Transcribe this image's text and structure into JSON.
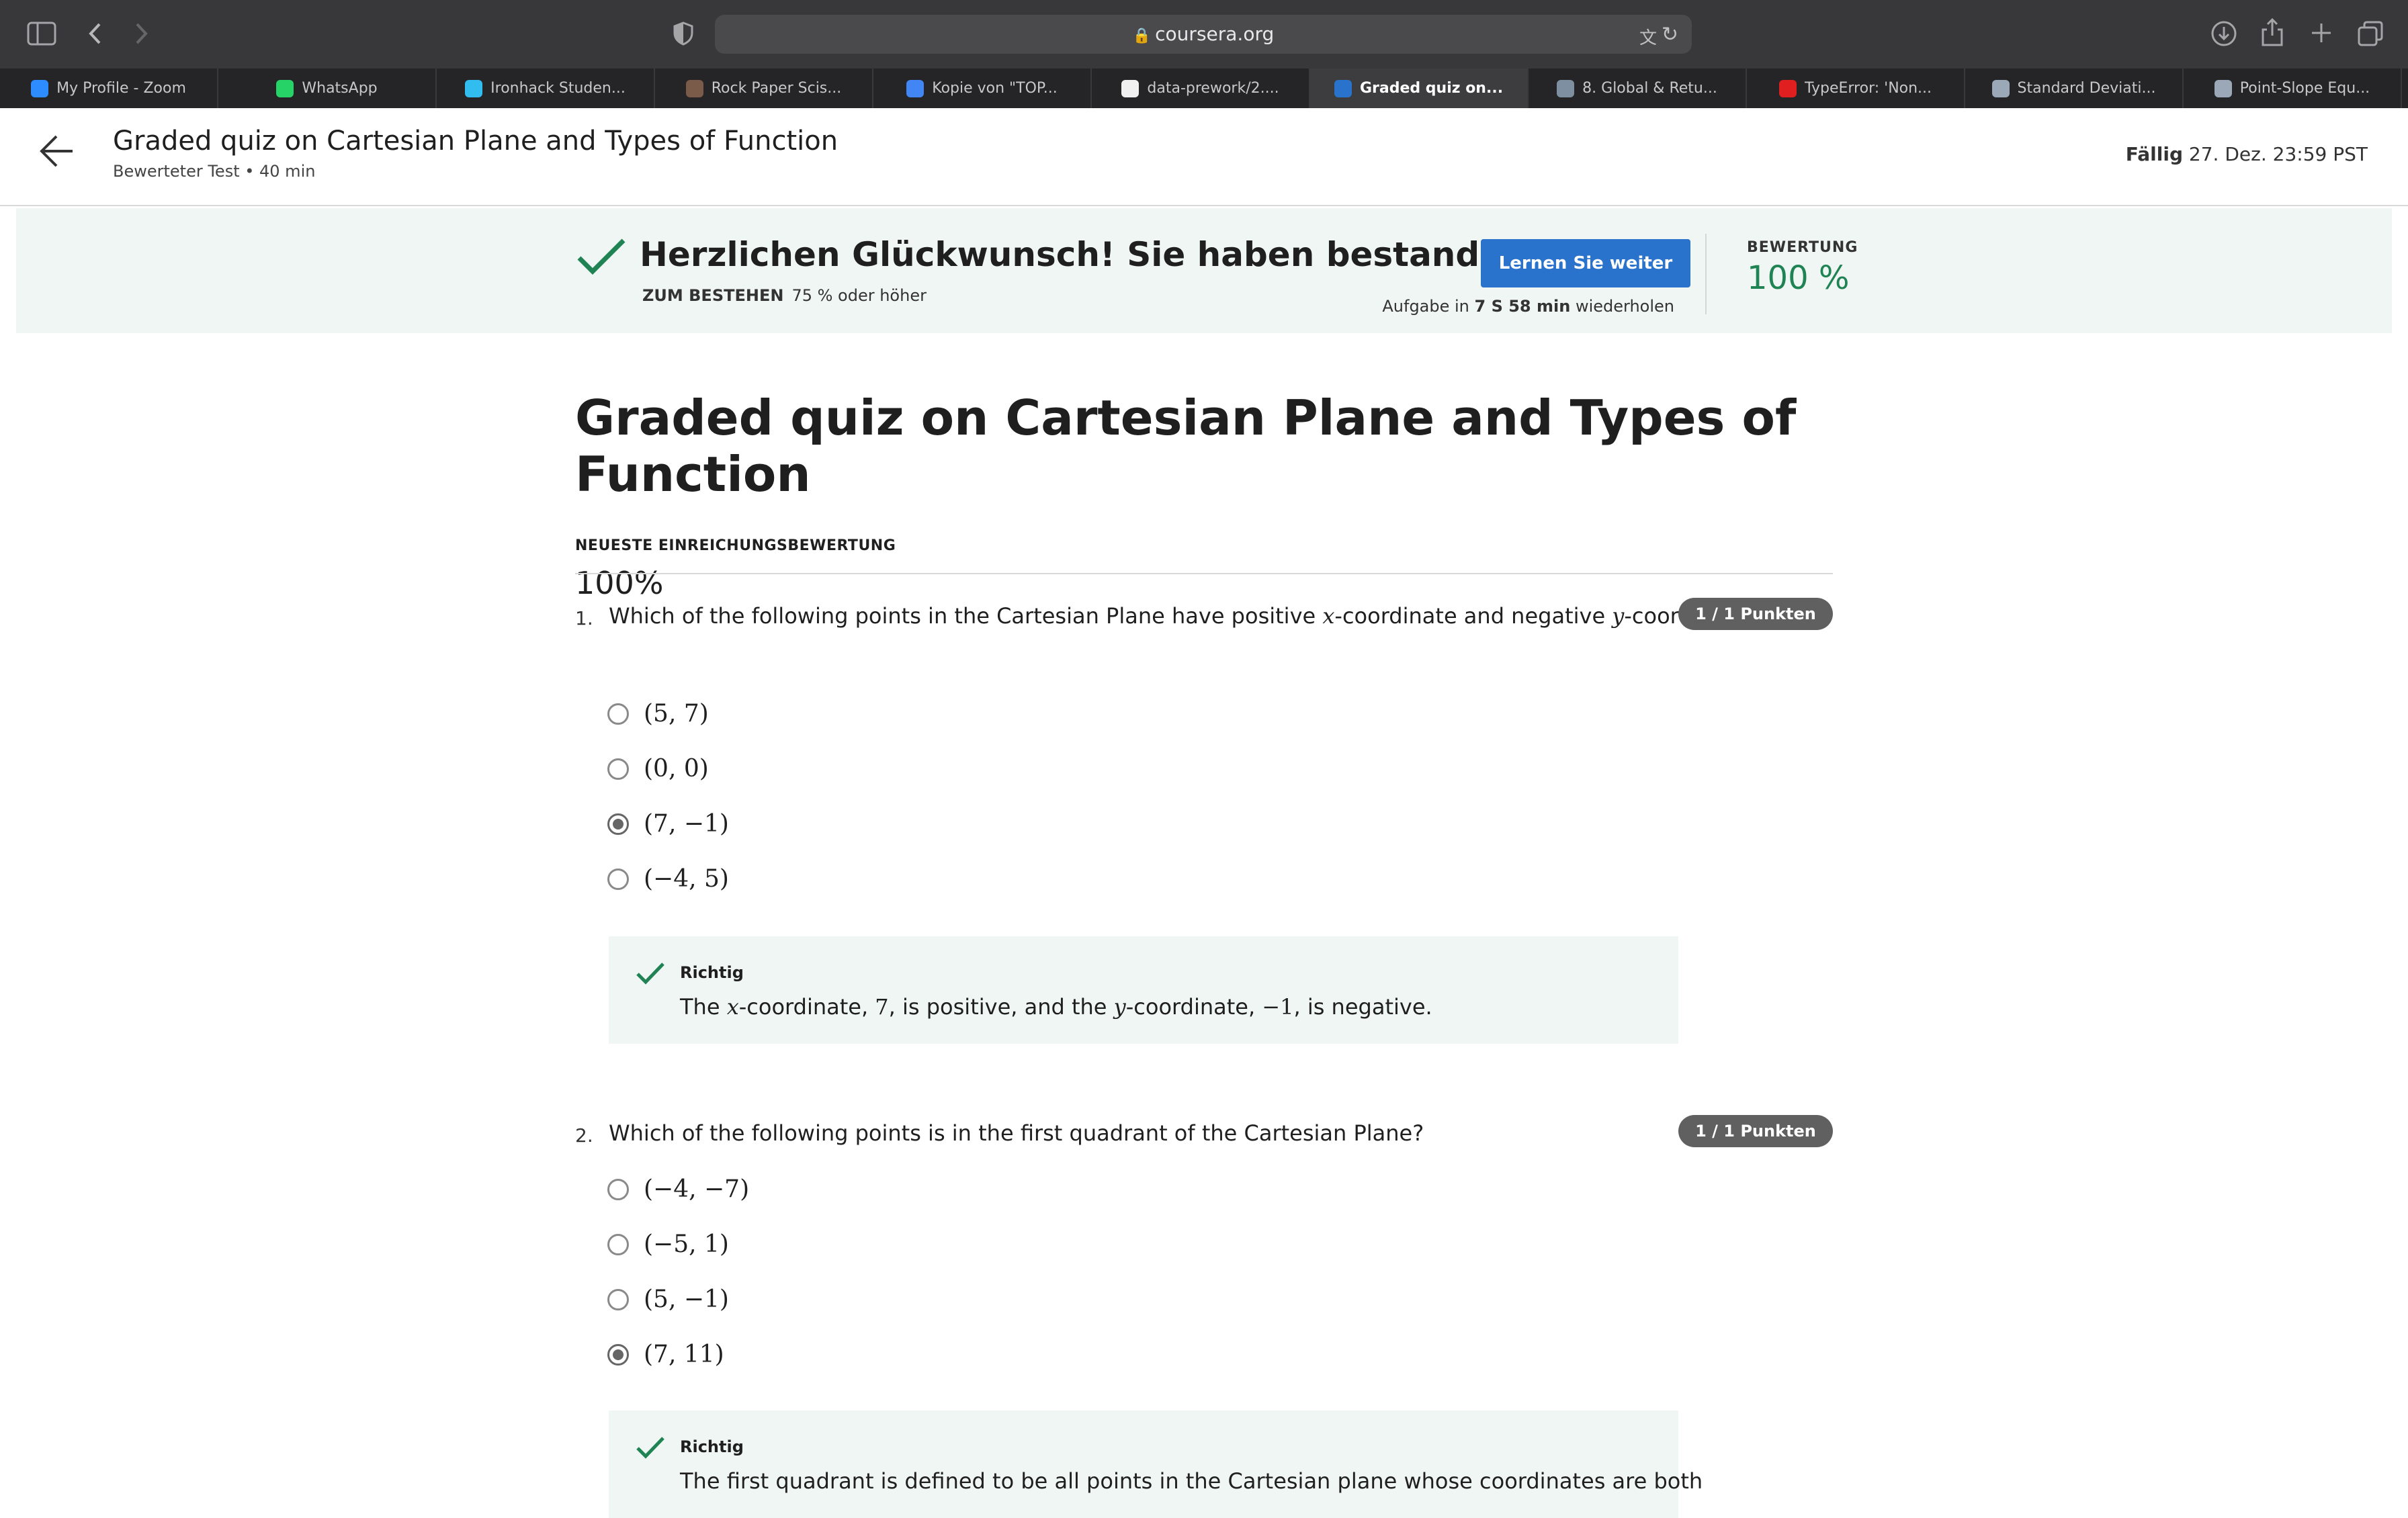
{
  "browser": {
    "url": "coursera.org",
    "tabs": [
      {
        "label": "My Profile - Zoom",
        "color": "#2d8cff"
      },
      {
        "label": "WhatsApp",
        "color": "#25d366"
      },
      {
        "label": "Ironhack Studen...",
        "color": "#32bdf0"
      },
      {
        "label": "Rock Paper Scis...",
        "color": "#7a5a48"
      },
      {
        "label": "Kopie von \"TOP...",
        "color": "#4285f4"
      },
      {
        "label": "data-prework/2....",
        "color": "#f0f0f0"
      },
      {
        "label": "Graded quiz on...",
        "color": "#2a73cc",
        "active": true
      },
      {
        "label": "8. Global & Retu...",
        "color": "#7d8fa0"
      },
      {
        "label": "TypeError: 'Non...",
        "color": "#e02020"
      },
      {
        "label": "Standard Deviati...",
        "color": "#9aa8b8"
      },
      {
        "label": "Point-Slope Equ...",
        "color": "#9aa8b8"
      }
    ]
  },
  "header": {
    "title": "Graded quiz on Cartesian Plane and Types of Function",
    "subtitle": "Bewerteter Test • 40 min",
    "due_label": "Fällig",
    "due_value": "27. Dez. 23:59 PST"
  },
  "banner": {
    "title": "Herzlichen Glückwunsch! Sie haben bestanden!",
    "pass_label": "ZUM BESTEHEN",
    "pass_value": "75 % oder höher",
    "continue_button": "Lernen Sie weiter",
    "retry_prefix": "Aufgabe in",
    "retry_time": "7 S 58 min",
    "retry_suffix": "wiederholen",
    "grade_label": "BEWERTUNG",
    "grade_value": "100 %"
  },
  "main": {
    "title": "Graded quiz on Cartesian Plane and Types of Function",
    "latest_label": "NEUESTE EINREICHUNGSBEWERTUNG",
    "latest_value": "100%"
  },
  "questions": [
    {
      "number": "1.",
      "text_parts": [
        "Which of the following points in the Cartesian Plane have positive ",
        "x",
        "-coordinate and negative ",
        "y",
        "-coordinate?"
      ],
      "points": "1 / 1 Punkten",
      "options": [
        "(5, 7)",
        "(0, 0)",
        "(7, −1)",
        "(−4, 5)"
      ],
      "selected": 2,
      "feedback_title": "Richtig",
      "feedback_parts": [
        "The ",
        "x",
        "-coordinate, ",
        "7",
        ", is positive, and the ",
        "y",
        "-coordinate, ",
        "−1",
        ", is negative."
      ]
    },
    {
      "number": "2.",
      "text": "Which of the following points is in the first quadrant of the Cartesian Plane?",
      "points": "1 / 1 Punkten",
      "options": [
        "(−4, −7)",
        "(−5, 1)",
        "(5, −1)",
        "(7, 11)"
      ],
      "selected": 3,
      "feedback_title": "Richtig",
      "feedback_text": "The first quadrant is defined to be all points in the Cartesian plane whose coordinates are both"
    }
  ]
}
